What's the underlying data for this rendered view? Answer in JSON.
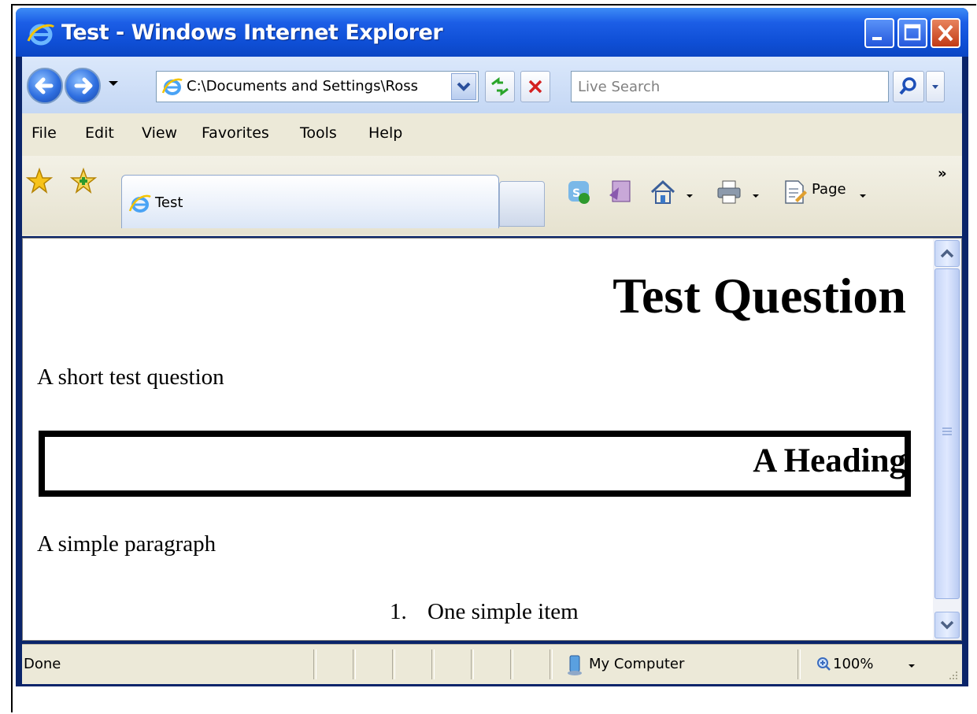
{
  "window": {
    "title": "Test - Windows Internet Explorer"
  },
  "address_bar": {
    "url": "C:\\Documents and Settings\\Ross"
  },
  "search": {
    "placeholder": "Live Search"
  },
  "menu": {
    "items": [
      "File",
      "Edit",
      "View",
      "Favorites",
      "Tools",
      "Help"
    ]
  },
  "tabs": {
    "active_label": "Test"
  },
  "command_bar": {
    "page_label": "Page",
    "more_label": "»"
  },
  "page": {
    "h1": "Test Question",
    "paragraph1": "A short test question",
    "h2": "A Heading",
    "paragraph2": "A simple paragraph",
    "list": [
      {
        "number": "1.",
        "text": "One simple item"
      }
    ]
  },
  "status": {
    "text": "Done",
    "zone": "My Computer",
    "zoom": "100%"
  },
  "icons": {
    "title": "ie-logo-icon",
    "nav": [
      "back-arrow-icon",
      "forward-arrow-icon"
    ],
    "command_bar": [
      "feeds-icon",
      "research-icon",
      "home-icon",
      "print-icon",
      "page-icon"
    ]
  },
  "colors": {
    "titlebar": "#0f4fd6",
    "chrome": "#ece9d8",
    "close_button": "#c23a14"
  }
}
